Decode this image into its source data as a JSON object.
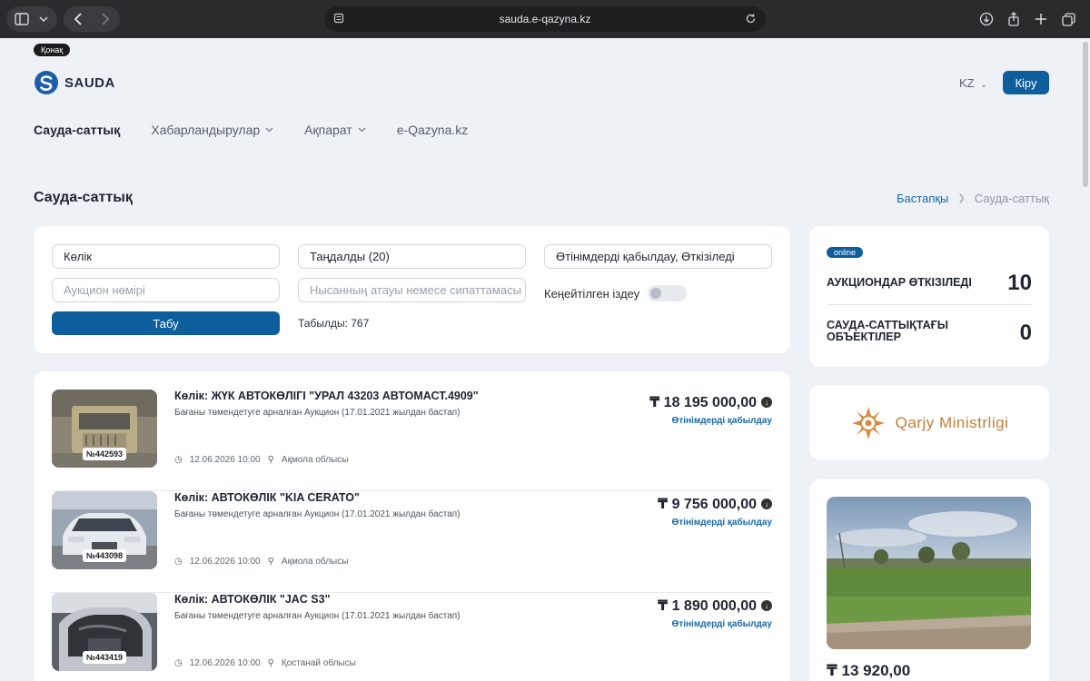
{
  "browser": {
    "url": "sauda.e-qazyna.kz"
  },
  "header": {
    "guest_badge": "Қонақ",
    "logo_text": "SAUDA",
    "lang": "KZ",
    "login_label": "Кіру"
  },
  "nav": {
    "items": [
      {
        "label": "Сауда-саттық",
        "active": true,
        "dropdown": false
      },
      {
        "label": "Хабарландырулар",
        "active": false,
        "dropdown": true
      },
      {
        "label": "Ақпарат",
        "active": false,
        "dropdown": true
      },
      {
        "label": "e-Qazyna.kz",
        "active": false,
        "dropdown": false
      }
    ]
  },
  "page": {
    "title": "Сауда-саттық",
    "breadcrumb_home": "Бастапқы",
    "breadcrumb_current": "Сауда-саттық"
  },
  "filters": {
    "category_value": "Көлік",
    "selected_value": "Таңдалды (20)",
    "status_value": "Өтінімдерді қабылдау, Өткізіледі",
    "auction_number_placeholder": "Аукцион нөмірі",
    "object_placeholder": "Нысанның атауы немесе сипаттамасы",
    "advanced_label": "Кеңейтілген іздеу",
    "search_label": "Табу",
    "found_label": "Табылды: 767"
  },
  "lots": [
    {
      "number": "№442593",
      "title": "Көлік: ЖҮК АВТОКӨЛІГІ \"УРАЛ 43203 АВТОМАСТ.4909\"",
      "subtitle": "Бағаны төмендетуге арналған Аукцион (17.01.2021 жылдан бастап)",
      "datetime": "12.06.2026 10:00",
      "region": "Ақмола облысы",
      "price": "₸ 18 195 000,00",
      "status": "Өтінімдерді қабылдау"
    },
    {
      "number": "№443098",
      "title": "Көлік: АВТОКӨЛІК \"KIA CERATO\"",
      "subtitle": "Бағаны төмендетуге арналған Аукцион (17.01.2021 жылдан бастап)",
      "datetime": "12.06.2026 10:00",
      "region": "Ақмола облысы",
      "price": "₸ 9 756 000,00",
      "status": "Өтінімдерді қабылдау"
    },
    {
      "number": "№443419",
      "title": "Көлік: АВТОКӨЛІК \"JAC S3\"",
      "subtitle": "Бағаны төмендетуге арналған Аукцион (17.01.2021 жылдан бастап)",
      "datetime": "12.06.2026 10:00",
      "region": "Қостанай облысы",
      "price": "₸ 1 890 000,00",
      "status": "Өтінімдерді қабылдау"
    }
  ],
  "stats": {
    "online_badge": "online",
    "auctions_label": "АУКЦИОНДАР ӨТКІЗІЛЕДІ",
    "auctions_value": "10",
    "objects_label": "САУДА-САТТЫҚТАҒЫ ОБЪЕКТІЛЕР",
    "objects_value": "0"
  },
  "ministry": {
    "text": "Qarjy Ministrligi"
  },
  "promo": {
    "price": "₸ 13 920,00"
  },
  "colors": {
    "brand": "#0f5e9c",
    "link": "#1769aa",
    "ministry": "#c77c35"
  }
}
